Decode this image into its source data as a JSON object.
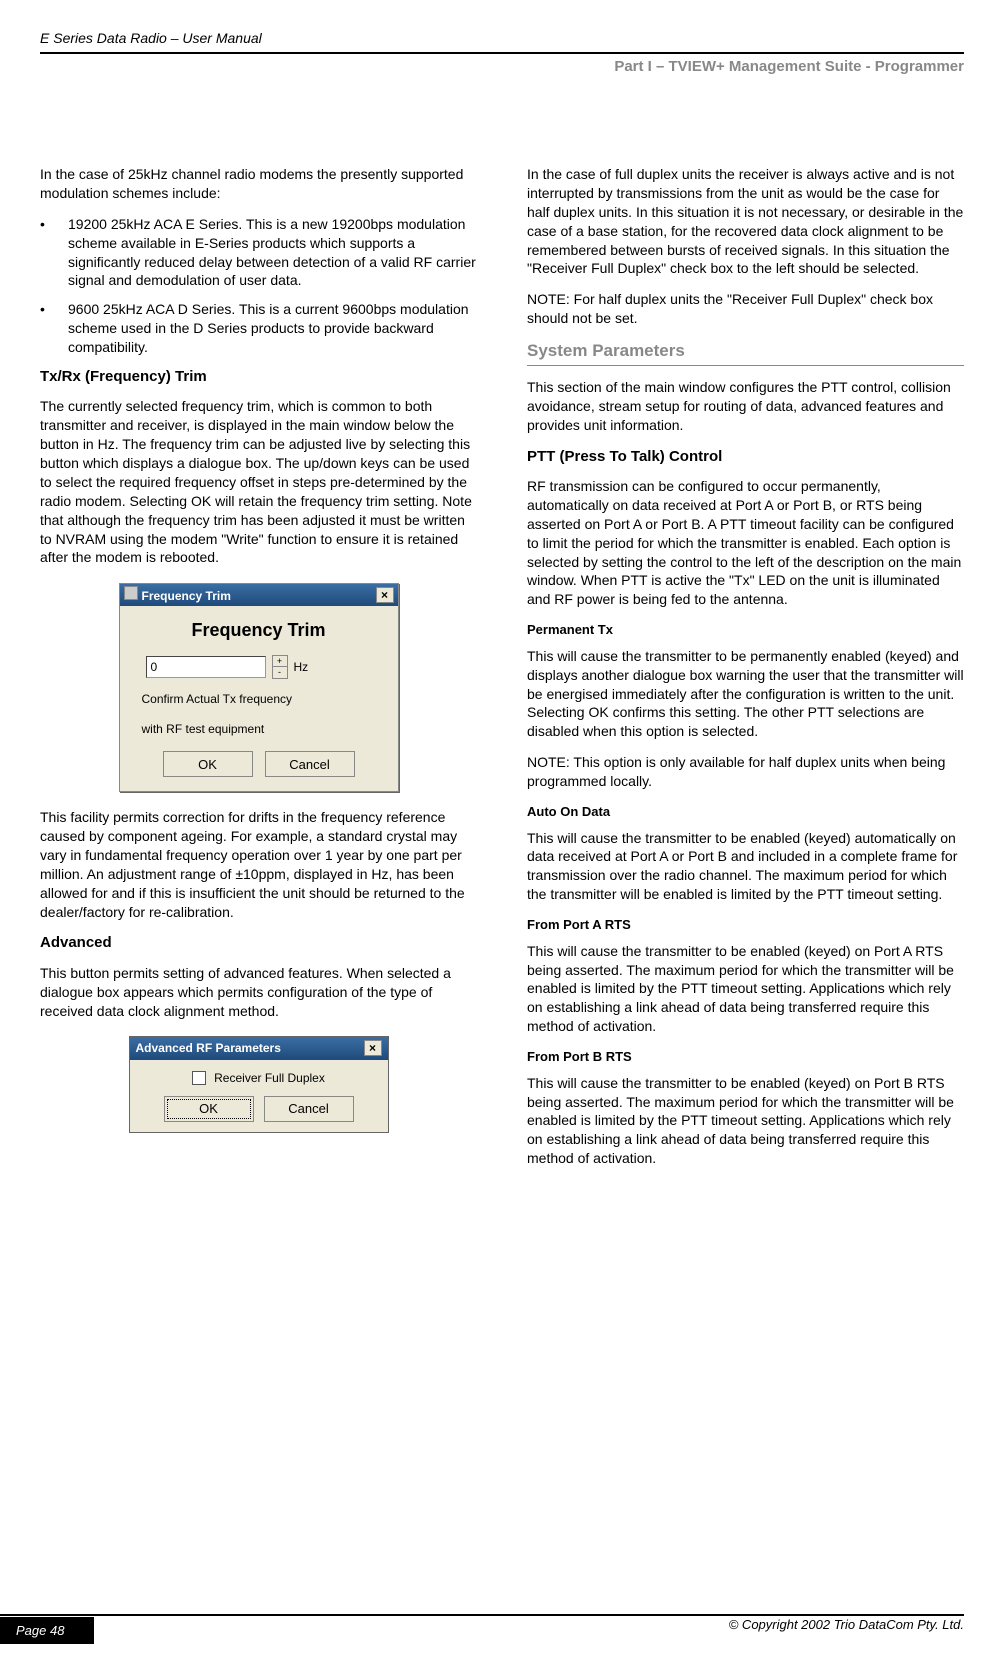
{
  "header": {
    "running": "E Series Data Radio – User Manual",
    "section": "Part I – TVIEW+ Management Suite - Programmer"
  },
  "left": {
    "intro": "In the case of 25kHz channel radio modems the presently supported modulation schemes include:",
    "bullets": [
      "19200 25kHz ACA E Series. This is a new 19200bps modulation scheme available in E-Series products which supports a significantly reduced delay between detection of a valid RF carrier signal and demodulation of user data.",
      "9600 25kHz ACA D Series. This is a current 9600bps modulation scheme used in the D Series products to provide backward compatibility."
    ],
    "txrx_heading": "Tx/Rx (Frequency) Trim",
    "txrx_para": "The currently selected frequency trim, which is common to both transmitter and receiver, is displayed in the main window below the button in Hz. The frequency trim can be adjusted live by selecting this button which displays a dialogue box. The up/down keys can be used to select the required frequency offset in steps pre-determined by the radio modem. Selecting OK will retain the frequency trim setting. Note that although the frequency trim has been adjusted it must be written to NVRAM using the modem \"Write\" function to ensure it is retained after the modem is rebooted.",
    "freq_dialog": {
      "title": "Frequency Trim",
      "heading": "Frequency Trim",
      "value": "0",
      "unit": "Hz",
      "note1": "Confirm Actual Tx frequency",
      "note2": "with RF test equipment",
      "ok": "OK",
      "cancel": "Cancel"
    },
    "facility_para": "This facility permits correction for drifts in the frequency reference caused by component ageing.  For example, a standard crystal may vary in fundamental frequency operation over 1 year by one part per million. An adjustment range of ±10ppm, displayed in Hz, has been allowed for and if this is insufficient the unit should be returned to the dealer/factory for re-calibration.",
    "advanced_heading": "Advanced",
    "advanced_para": "This button permits setting of advanced features. When selected a dialogue box appears which permits configuration of the type of received data clock alignment method.",
    "adv_dialog": {
      "title": "Advanced RF Parameters",
      "checkbox": "Receiver Full Duplex",
      "ok": "OK",
      "cancel": "Cancel"
    }
  },
  "right": {
    "duplex_para": "In the case of full duplex units the receiver is always active and is not interrupted by transmissions from the unit as would be the case for half duplex units. In this situation it is not necessary, or desirable in the case of a base station, for the recovered data clock alignment to be remembered between bursts of received signals. In this situation the \"Receiver Full Duplex\" check box to the left should be selected.",
    "note_para": "NOTE: For half duplex units the \"Receiver Full Duplex\" check box should not be set.",
    "sys_heading": "System Parameters",
    "sys_intro": "This section of the main window configures the PTT control, collision avoidance, stream setup for routing of data, advanced features and provides unit information.",
    "ptt_heading": "PTT (Press To Talk) Control",
    "ptt_para": "RF transmission can be configured to occur permanently, automatically on data received at Port A or Port B, or RTS being asserted on Port A or Port B. A PTT timeout facility can be configured to limit the period for which the transmitter is enabled. Each option is selected by setting the control to the left of the description on the main window. When PTT is active the \"Tx\" LED on the unit is illuminated and RF power is being fed to the antenna.",
    "perm_h": "Permanent Tx",
    "perm_p": "This will cause the transmitter to be permanently enabled (keyed) and displays another dialogue box warning the user that the transmitter will be energised immediately after the configuration is written to the unit. Selecting OK confirms this setting. The other PTT selections are disabled when this option is selected.",
    "perm_note": "NOTE: This option is only available for half duplex units when being programmed locally.",
    "auto_h": "Auto On Data",
    "auto_p": "This will cause the transmitter to be enabled (keyed) automatically on data received at Port A or Port B and included in a complete frame for transmission over the radio channel. The maximum period for which the transmitter will be enabled is limited by the PTT timeout setting.",
    "prta_h": "From Port A RTS",
    "prta_p": "This will cause the transmitter to be enabled (keyed) on Port A RTS being asserted. The maximum period for which the transmitter will be enabled is limited by the PTT timeout setting. Applications which rely on establishing a link ahead of data being transferred require this method of activation.",
    "prtb_h": "From Port B RTS",
    "prtb_p": "This will cause the transmitter to be enabled (keyed) on Port B RTS being asserted. The maximum period for which the transmitter will be enabled is limited by the PTT timeout setting. Applications which rely on establishing a link ahead of data being transferred require this method of activation."
  },
  "footer": {
    "page": "Page 48",
    "copyright": "© Copyright 2002 Trio DataCom Pty. Ltd."
  }
}
